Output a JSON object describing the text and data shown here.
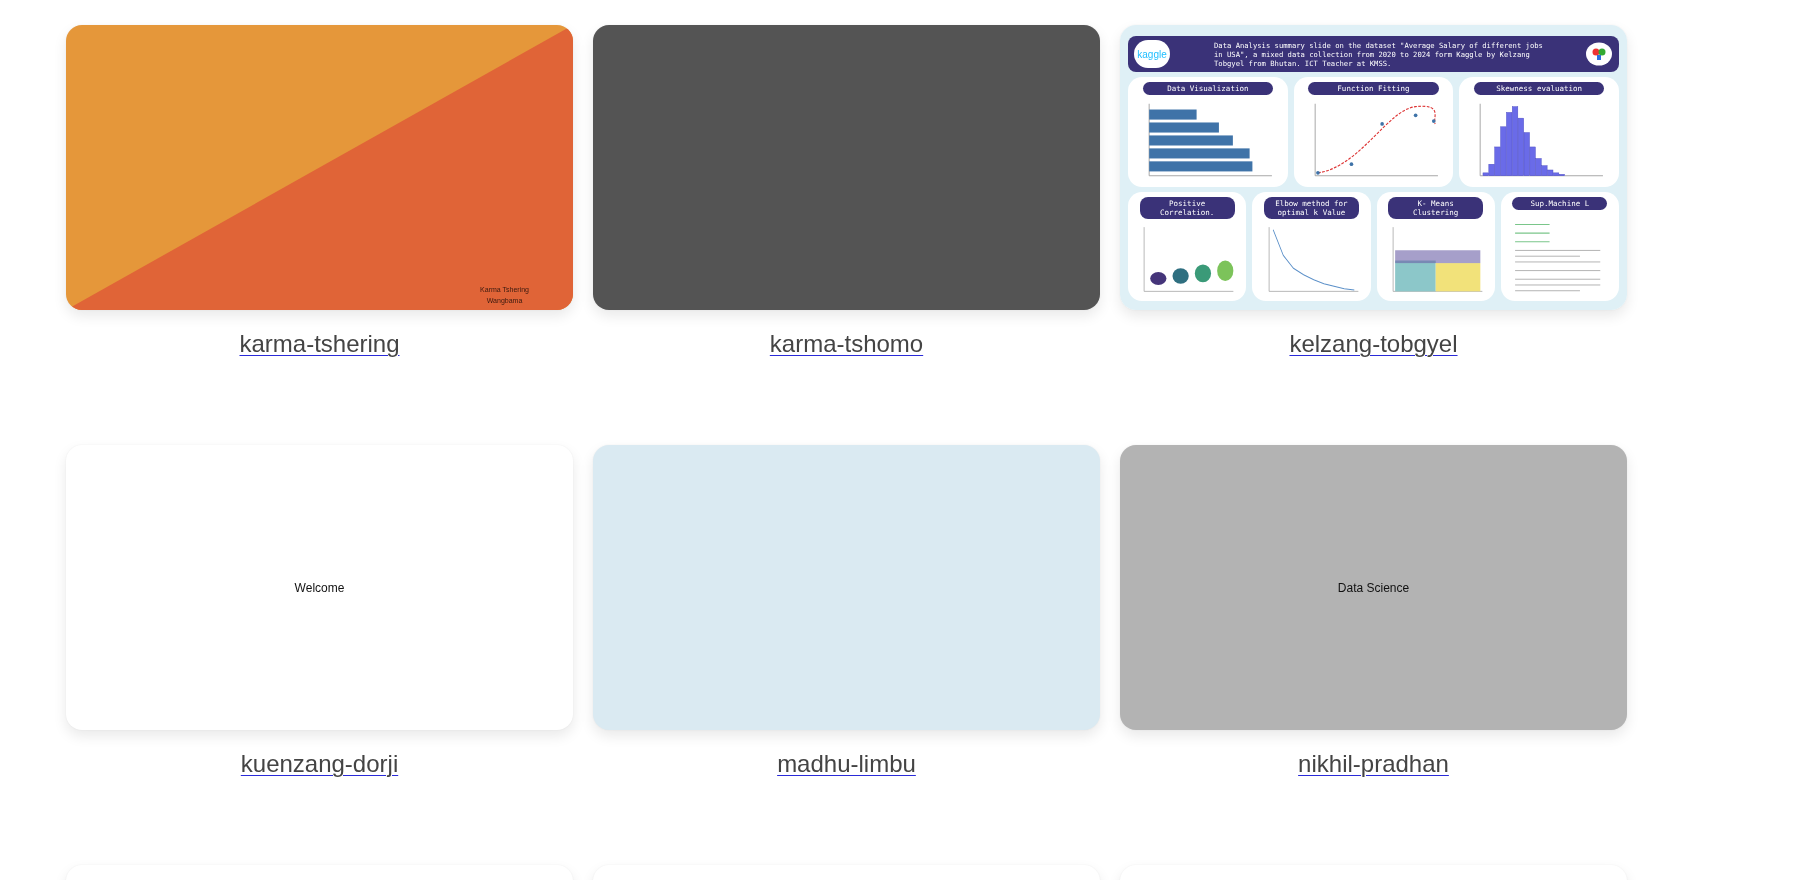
{
  "cards": [
    {
      "kind": "diagonal",
      "label": "karma-tshering",
      "color": "#e5973a",
      "triangle": {
        "color": "#e06437"
      },
      "text_lines": [
        "Karma Tshering",
        "Wangbama"
      ]
    },
    {
      "kind": "solid",
      "label": "karma-tshomo",
      "color": "#545454"
    },
    {
      "kind": "slide",
      "label": "kelzang-tobgyel",
      "slide": {
        "logo_text": "kaggle",
        "header": "Data Analysis summary slide on the dataset \"Average Salary of different jobs in USA\", a mixed data collection from 2020 to 2024 form Kaggle by Kelzang Tobgyel from Bhutan. ICT Teacher at KMSS.",
        "top_panels": [
          {
            "title": "Data Visualization",
            "kind": "bars"
          },
          {
            "title": "Function Fitting",
            "kind": "curve"
          },
          {
            "title": "Skewness evaluation",
            "kind": "histogram"
          }
        ],
        "bottom_panels": [
          {
            "title": "Positive Correlation.",
            "kind": "violin"
          },
          {
            "title": "Elbow method for optimal k Value",
            "kind": "elbow"
          },
          {
            "title": "K- Means Clustering",
            "kind": "scatter"
          },
          {
            "title": "Sup.Machine L",
            "kind": "lines"
          }
        ]
      }
    },
    {
      "kind": "solid",
      "label": "kuenzang-dorji",
      "color": "#ffffff",
      "text": "Welcome"
    },
    {
      "kind": "solid",
      "label": "madhu-limbu",
      "color": "#daeaf2"
    },
    {
      "kind": "solid",
      "label": "nikhil-pradhan",
      "color": "#b3b3b3",
      "text": "Data Science"
    },
    {
      "kind": "solid",
      "color": "#ffffff"
    },
    {
      "kind": "solid",
      "color": "#ffffff"
    },
    {
      "kind": "solid",
      "color": "#ffffff"
    }
  ]
}
